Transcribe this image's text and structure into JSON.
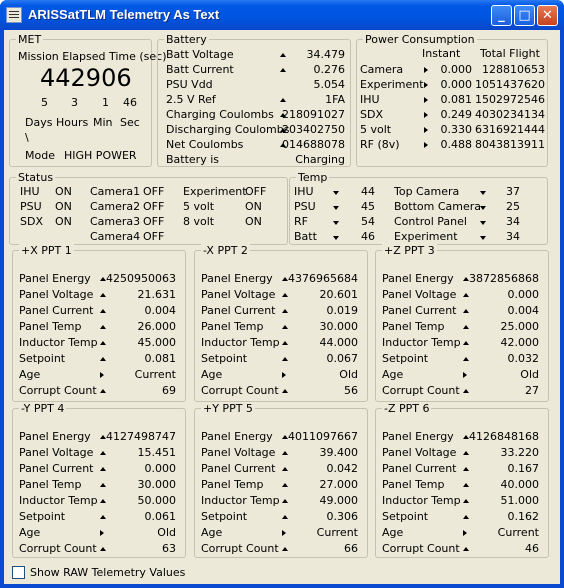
{
  "window": {
    "title": "ARISSatTLM Telemetry As Text"
  },
  "met": {
    "group": "MET",
    "label": "Mission Elapsed Time (sec)",
    "value": "442906",
    "parts": [
      "5",
      "3",
      "1",
      "46"
    ],
    "units": [
      "Days",
      "Hours",
      "Min",
      "Sec"
    ],
    "mode_label": "Mode",
    "mode_value": "HIGH POWER",
    "backslash": "\\"
  },
  "battery": {
    "group": "Battery",
    "rows": [
      {
        "label": "Batt Voltage",
        "value": "34.479"
      },
      {
        "label": "Batt Current",
        "value": "0.276"
      },
      {
        "label": "PSU Vdd",
        "value": "5.054"
      },
      {
        "label": "2.5 V Ref",
        "value": "1FA"
      },
      {
        "label": "Charging Coulombs",
        "value": "218091027"
      },
      {
        "label": "Discharging Coulombs",
        "value": "203402750"
      },
      {
        "label": "Net Coulombs",
        "value": "014688078"
      },
      {
        "label": "Battery is",
        "value": "Charging"
      }
    ]
  },
  "power": {
    "group": "Power Consumption",
    "col_instant": "Instant",
    "col_total": "Total Flight",
    "rows": [
      {
        "label": "Camera",
        "instant": "0.000",
        "total": "128810653"
      },
      {
        "label": "Experiment",
        "instant": "0.000",
        "total": "1051437620"
      },
      {
        "label": "IHU",
        "instant": "0.081",
        "total": "1502972546"
      },
      {
        "label": "SDX",
        "instant": "0.249",
        "total": "4030234134"
      },
      {
        "label": "5 volt",
        "instant": "0.330",
        "total": "6316921444"
      },
      {
        "label": "RF (8v)",
        "instant": "0.488",
        "total": "8043813911"
      }
    ]
  },
  "status": {
    "group": "Status",
    "c1": [
      {
        "label": "IHU",
        "value": "ON"
      },
      {
        "label": "PSU",
        "value": "ON"
      },
      {
        "label": "SDX",
        "value": "ON"
      }
    ],
    "c2": [
      {
        "label": "Camera1",
        "value": "OFF"
      },
      {
        "label": "Camera2",
        "value": "OFF"
      },
      {
        "label": "Camera3",
        "value": "OFF"
      },
      {
        "label": "Camera4",
        "value": "OFF"
      }
    ],
    "c3": [
      {
        "label": "Experiment",
        "value": "OFF"
      },
      {
        "label": "5 volt",
        "value": "ON"
      },
      {
        "label": "8 volt",
        "value": "ON"
      }
    ]
  },
  "temp": {
    "group": "Temp",
    "left": [
      {
        "label": "IHU",
        "value": "44"
      },
      {
        "label": "PSU",
        "value": "45"
      },
      {
        "label": "RF",
        "value": "54"
      },
      {
        "label": "Batt",
        "value": "46"
      }
    ],
    "right": [
      {
        "label": "Top Camera",
        "value": "37"
      },
      {
        "label": "Bottom Camera",
        "value": "25"
      },
      {
        "label": "Control Panel",
        "value": "34"
      },
      {
        "label": "Experiment",
        "value": "34"
      }
    ]
  },
  "ppt_labels": [
    "Panel Energy",
    "Panel Voltage",
    "Panel Current",
    "Panel Temp",
    "Inductor Temp",
    "Setpoint",
    "Age",
    "Corrupt Count"
  ],
  "ppts": [
    {
      "title": "+X PPT 1",
      "values": [
        "4250950063",
        "21.631",
        "0.004",
        "26.000",
        "45.000",
        "0.081",
        "Current",
        "69"
      ]
    },
    {
      "title": "-X PPT 2",
      "values": [
        "4376965684",
        "20.601",
        "0.019",
        "30.000",
        "44.000",
        "0.067",
        "Old",
        "56"
      ]
    },
    {
      "title": "+Z PPT 3",
      "values": [
        "3872856868",
        "0.000",
        "0.004",
        "25.000",
        "42.000",
        "0.032",
        "Old",
        "27"
      ]
    },
    {
      "title": "-Y PPT 4",
      "values": [
        "4127498747",
        "15.451",
        "0.000",
        "30.000",
        "50.000",
        "0.061",
        "Old",
        "63"
      ]
    },
    {
      "title": "+Y PPT 5",
      "values": [
        "4011097667",
        "39.400",
        "0.042",
        "27.000",
        "49.000",
        "0.306",
        "Current",
        "66"
      ]
    },
    {
      "title": "-Z PPT 6",
      "values": [
        "4126848168",
        "33.220",
        "0.167",
        "40.000",
        "51.000",
        "0.162",
        "Current",
        "46"
      ]
    }
  ],
  "raw_checkbox": {
    "label": "Show RAW Telemetry Values",
    "checked": false
  },
  "icons": {
    "up": "up-arrow-icon",
    "down": "down-arrow-icon",
    "right": "right-arrow-icon"
  }
}
